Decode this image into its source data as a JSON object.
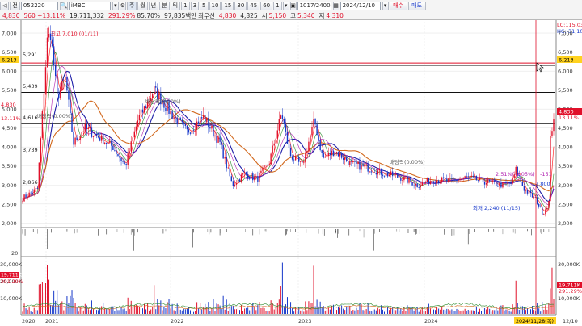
{
  "toolbar": {
    "code": "052220",
    "name": "iMBC",
    "price": "4,830",
    "change": "560 +13.11%",
    "volume": "19,711,332",
    "vol_ratio": "291.29%",
    "ratio2": "85.70%",
    "amount": "97,835백만",
    "pref_label": "최우선",
    "best_ask": "4,830",
    "best_bid": "4,825",
    "open_label": "시",
    "open": "5,150",
    "high_label": "고",
    "high": "5,340",
    "low_label": "저",
    "low": "4,310",
    "count": "1017/2400",
    "date": "2024/12/10",
    "buy_label": "매수",
    "sell_label": "매도",
    "period_tabs": [
      "주",
      "월",
      "년",
      "분",
      "틱"
    ],
    "interval_tabs": [
      "1",
      "3",
      "5",
      "10",
      "15",
      "30",
      "45",
      "60",
      "1"
    ],
    "left_glyphs": [
      "◁",
      "전"
    ]
  },
  "chart_data": {
    "type": "candlestick",
    "ylim": [
      1900,
      7300
    ],
    "y_ticks": [
      "7,000",
      "6,500",
      "6,000",
      "5,500",
      "5,000",
      "4,500",
      "4,000",
      "3,500",
      "3,000",
      "2,500",
      "2,000"
    ],
    "x_labels": [
      "2020",
      "2021",
      "2022",
      "2023",
      "2024",
      "2024/11/28(목)",
      "12/10"
    ],
    "h_levels": [
      {
        "value": 6213,
        "label": "6,213",
        "tag": "6,213"
      },
      {
        "value": 5291,
        "label": "5,291"
      },
      {
        "value": 5439,
        "label": "5,439"
      },
      {
        "value": 4616,
        "label": "4,616"
      },
      {
        "value": 3739,
        "label": "3,739"
      },
      {
        "value": 2866,
        "label": "2,866"
      }
    ],
    "max_label": "최고 7,010 (01/11)",
    "min_label": "최저 2,240 (11/15)",
    "annotations": [
      "배당락(0.00%)",
      "배당락(0.00%)",
      "배당락(0.00%)",
      "2.51%(-9.05%)",
      "-151",
      "2,800"
    ],
    "right_labels": {
      "lc": "LC:115,03",
      "hc": "HC:-31,10",
      "current_price": "4,830",
      "change_pct": "13.11%",
      "vol_current": "19,711K",
      "vol_ratio": "291.29%"
    },
    "volume": {
      "y_ticks": [
        "30,000K",
        "20,000K",
        "10,000K"
      ],
      "left_value": "19,711K",
      "left_ratio": "291.29%"
    },
    "panel_tick": "20",
    "colors": {
      "up": "#e0102a",
      "down": "#1537c9",
      "ma_short": "#ff2a2a",
      "ma_mid": "#1e1ea8",
      "ma_long": "#d2691e",
      "ma_green": "#2a8a2a",
      "ma_purple": "#b020b0"
    }
  }
}
